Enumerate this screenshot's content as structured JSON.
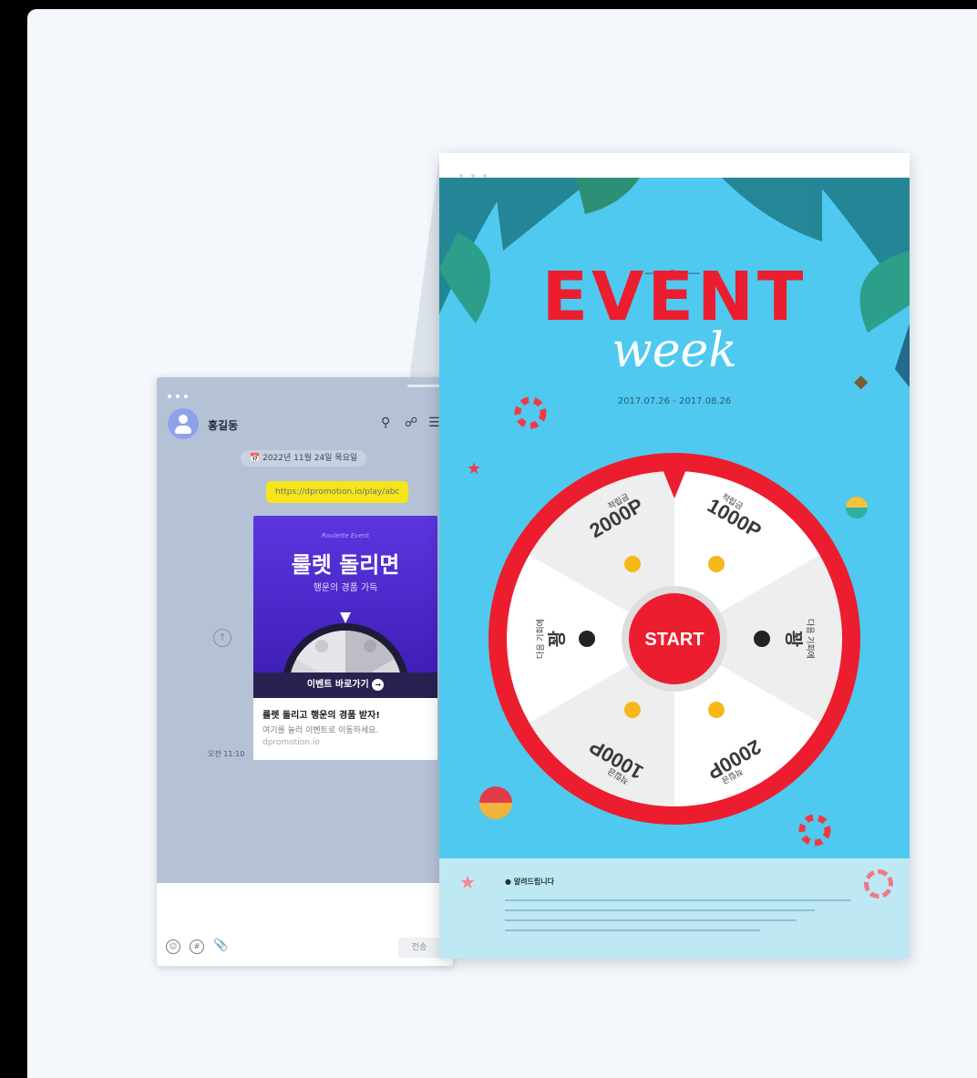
{
  "messenger": {
    "user_name": "홍길동",
    "date_chip": "2022년 11월 24일 목요일",
    "link_text": "https://dpromotion.io/play/abc",
    "card": {
      "small_title": "Roulette Event",
      "title": "룰렛 돌리면",
      "subtitle": "행운의 경품 가득",
      "cta": "이벤트 바로가기",
      "headline": "룰렛 돌리고 행운의 경품 받자!",
      "desc": "여기를 눌러 이벤트로 이동하세요.",
      "domain": "dpromotion.io"
    },
    "time": "오전 11:10",
    "send_label": "전송"
  },
  "event": {
    "title": "EVENT",
    "subtitle": "week",
    "date_range": "2017.07.26 - 2017.08.26",
    "start_label": "START",
    "segments": [
      {
        "label": "적립금",
        "value": "2000P"
      },
      {
        "label": "적립금",
        "value": "1000P"
      },
      {
        "label": "다음 기회에",
        "value": "꽝"
      },
      {
        "label": "적립금",
        "value": "2000P"
      },
      {
        "label": "적립금",
        "value": "1000P"
      },
      {
        "label": "다음 기회에",
        "value": "꽝"
      }
    ],
    "notice_title": "알려드립니다"
  },
  "colors": {
    "accent_red": "#ec1d2e",
    "sky": "#4fc9ef",
    "kakao_yellow": "#f4e61a",
    "card_purple": "#4a28cc"
  }
}
